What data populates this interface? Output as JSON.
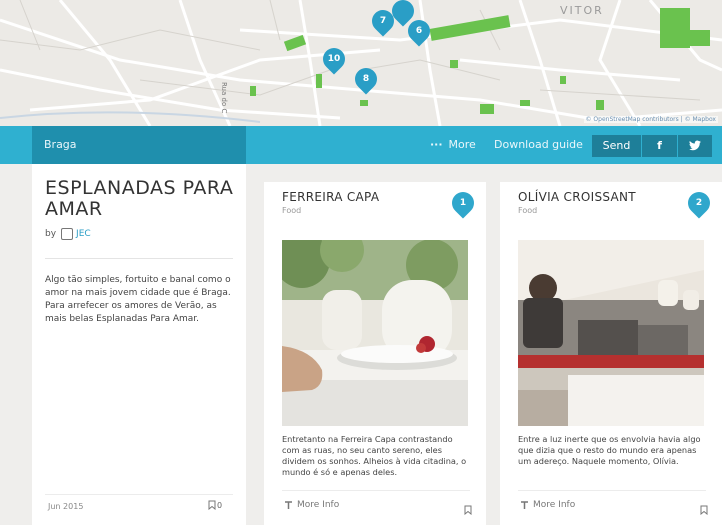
{
  "map": {
    "area_label": "VITOR",
    "street_label": "Rua do C",
    "attribution": "© OpenStreetMap contributors | © Mapbox",
    "pins": [
      "7",
      "6",
      "10",
      "8"
    ]
  },
  "toolbar": {
    "city": "Braga",
    "more_label": "More",
    "download_label": "Download guide",
    "send_label": "Send",
    "facebook_label": "f"
  },
  "guide": {
    "title": "ESPLANADAS PARA AMAR",
    "by_label": "by",
    "author": "JEC",
    "description": "Algo tão simples, fortuito e banal como o amor na mais jovem cidade que é Braga. Para arrefecer os amores de Verão, as mais belas Esplanadas Para Amar.",
    "date": "Jun 2015",
    "saves": "0"
  },
  "places": [
    {
      "name": "FERREIRA CAPA",
      "category": "Food",
      "number": "1",
      "description": "Entretanto na Ferreira Capa contrastando com as ruas, no seu canto sereno, eles dividem os sonhos. Alheios à vida citadina, o mundo é só e apenas deles.",
      "more_info": "More Info"
    },
    {
      "name": "OLÍVIA CROISSANT",
      "category": "Food",
      "number": "2",
      "description": "Entre a luz inerte que os envolvia havia algo que dizia que o resto do mundo era apenas um adereço. Naquele momento, Olívia.",
      "more_info": "More Info"
    }
  ],
  "colors": {
    "toolbar": "#2fb0d0",
    "city_tab": "#1f8fad",
    "accent": "#2a9ec6"
  }
}
